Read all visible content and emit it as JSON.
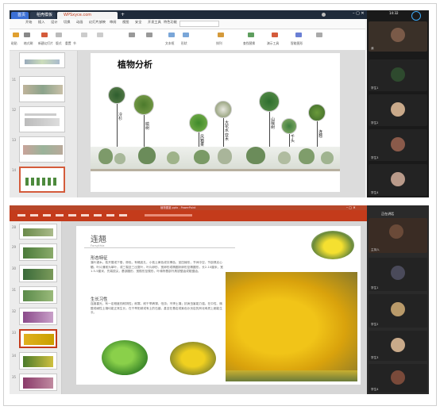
{
  "top_window": {
    "tabs": [
      "首页",
      "稻壳模板",
      "WPSxyce.com"
    ],
    "ribbon_tabs": [
      "开始",
      "插入",
      "设计",
      "切换",
      "动画",
      "幻灯片放映",
      "审阅",
      "视图",
      "安全",
      "开发工具",
      "特色功能"
    ],
    "toolbar_labels": [
      "粘贴",
      "格式刷",
      "新建幻灯片",
      "版式",
      "重置",
      "节",
      "文本框",
      "形状",
      "排列",
      "查找替换",
      "演示工具",
      "智能图形"
    ],
    "thumb_numbers": [
      "11",
      "12",
      "13",
      "14",
      "15"
    ],
    "slide": {
      "title": "植物分析",
      "labels": [
        "冷杉",
        "榆树",
        "风箱果",
        "大花水亚木",
        "山檀树",
        "千头",
        "连翘"
      ]
    },
    "participant_names": [
      "我",
      "学生1",
      "学生2",
      "学生3",
      "学生4"
    ],
    "time": "14:32"
  },
  "bottom_window": {
    "title_bar": "植物图鉴.pptx - PowerPoint",
    "thumb_numbers": [
      "28",
      "29",
      "30",
      "31",
      "32",
      "33",
      "34",
      "35"
    ],
    "slide": {
      "title": "连翘",
      "subtitle": "Forsythia",
      "section1": "形态特征",
      "body1": "落叶灌木。枝开展或下垂，棕色，有略皮孔，小枝土黄色或灰褐色，呈四棱形，节间中空，节部具实心髓。叶片通常为单叶，或三裂至三出复叶，叶片卵形、宽卵形或椭圆状卵形至椭圆形，长2-10厘米，宽1.5-5厘米，先端锐尖，基部圆形、宽楔形至楔形，叶缘除基部外具锐锯齿或粗锯齿。",
      "section2": "生长习性",
      "body2": "连翘喜光，有一定程度的耐阴性；耐寒，耐干旱瘠薄，怕涝；不择土壤；抗病虫害能力强。在中性、微酸或碱性土壤均能正常生长。在干旱阳坡或有土的石缝，甚至在基岩或紫色沙页岩的风化母质上都能生长。"
    },
    "participant_names": [
      "主持人",
      "学生1",
      "学生2",
      "学生3",
      "学生4"
    ],
    "meeting_label": "正在讲话"
  },
  "colors": {
    "accent": "#c43b1b",
    "titlebar": "#1e2a3a",
    "video_bg": "#1a1a1a"
  }
}
